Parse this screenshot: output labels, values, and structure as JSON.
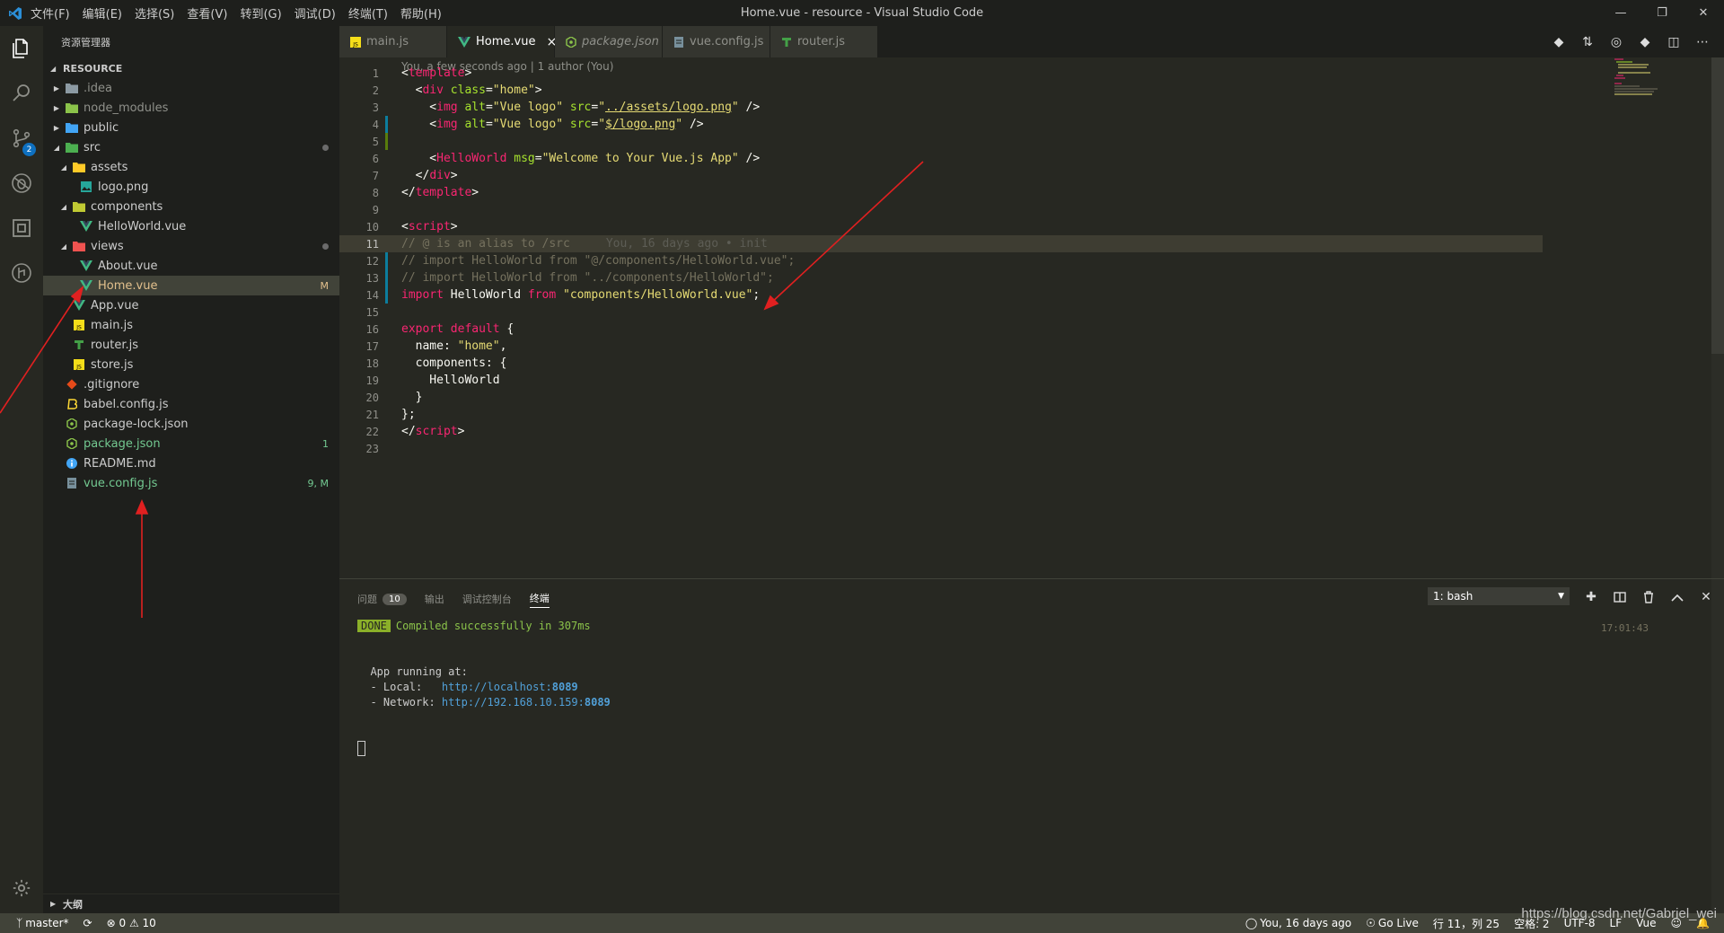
{
  "titlebar": {
    "menus": [
      "文件(F)",
      "编辑(E)",
      "选择(S)",
      "查看(V)",
      "转到(G)",
      "调试(D)",
      "终端(T)",
      "帮助(H)"
    ],
    "title": "Home.vue - resource - Visual Studio Code"
  },
  "activity": {
    "scm_badge": "2"
  },
  "sidebar": {
    "header": "资源管理器",
    "section": "RESOURCE",
    "items": [
      {
        "label": ".idea",
        "depth": 0,
        "twisty": "▶",
        "icon": "folder-icon",
        "color": "#8f908a",
        "status": ""
      },
      {
        "label": "node_modules",
        "depth": 0,
        "twisty": "▶",
        "icon": "folder-node-icon",
        "color": "#8f908a",
        "status": ""
      },
      {
        "label": "public",
        "depth": 0,
        "twisty": "▶",
        "icon": "folder-public-icon",
        "color": "#cccccc",
        "status": ""
      },
      {
        "label": "src",
        "depth": 0,
        "twisty": "◢",
        "icon": "folder-src-icon",
        "color": "#cccccc",
        "status": "dot"
      },
      {
        "label": "assets",
        "depth": 1,
        "twisty": "◢",
        "icon": "folder-assets-icon",
        "color": "#cccccc",
        "status": ""
      },
      {
        "label": "logo.png",
        "depth": 2,
        "twisty": "",
        "icon": "image-icon",
        "color": "#cccccc",
        "status": ""
      },
      {
        "label": "components",
        "depth": 1,
        "twisty": "◢",
        "icon": "folder-components-icon",
        "color": "#cccccc",
        "status": ""
      },
      {
        "label": "HelloWorld.vue",
        "depth": 2,
        "twisty": "",
        "icon": "vue-icon",
        "color": "#cccccc",
        "status": ""
      },
      {
        "label": "views",
        "depth": 1,
        "twisty": "◢",
        "icon": "folder-views-icon",
        "color": "#cccccc",
        "status": "dot"
      },
      {
        "label": "About.vue",
        "depth": 2,
        "twisty": "",
        "icon": "vue-icon",
        "color": "#cccccc",
        "status": ""
      },
      {
        "label": "Home.vue",
        "depth": 2,
        "twisty": "",
        "icon": "vue-icon",
        "color": "#e2c08d",
        "status": "M",
        "selected": true
      },
      {
        "label": "App.vue",
        "depth": 1,
        "twisty": "",
        "icon": "vue-icon",
        "color": "#cccccc",
        "status": ""
      },
      {
        "label": "main.js",
        "depth": 1,
        "twisty": "",
        "icon": "js-icon",
        "color": "#cccccc",
        "status": ""
      },
      {
        "label": "router.js",
        "depth": 1,
        "twisty": "",
        "icon": "router-icon",
        "color": "#cccccc",
        "status": ""
      },
      {
        "label": "store.js",
        "depth": 1,
        "twisty": "",
        "icon": "js-icon",
        "color": "#cccccc",
        "status": ""
      },
      {
        "label": ".gitignore",
        "depth": 0,
        "twisty": "",
        "icon": "git-icon",
        "color": "#cccccc",
        "status": ""
      },
      {
        "label": "babel.config.js",
        "depth": 0,
        "twisty": "",
        "icon": "babel-icon",
        "color": "#cccccc",
        "status": ""
      },
      {
        "label": "package-lock.json",
        "depth": 0,
        "twisty": "",
        "icon": "npm-icon",
        "color": "#cccccc",
        "status": ""
      },
      {
        "label": "package.json",
        "depth": 0,
        "twisty": "",
        "icon": "npm-icon",
        "color": "#73c991",
        "status": "1"
      },
      {
        "label": "README.md",
        "depth": 0,
        "twisty": "",
        "icon": "info-icon",
        "color": "#cccccc",
        "status": ""
      },
      {
        "label": "vue.config.js",
        "depth": 0,
        "twisty": "",
        "icon": "config-icon",
        "color": "#73c991",
        "status": "9, M"
      }
    ],
    "outline": "大纲"
  },
  "tabs": [
    {
      "label": "main.js",
      "icon": "js-icon",
      "active": false,
      "italic": false
    },
    {
      "label": "Home.vue",
      "icon": "vue-icon",
      "active": true,
      "italic": false
    },
    {
      "label": "package.json",
      "icon": "npm-icon",
      "active": false,
      "italic": true
    },
    {
      "label": "vue.config.js",
      "icon": "config-icon",
      "active": false,
      "italic": false
    },
    {
      "label": "router.js",
      "icon": "router-icon",
      "active": false,
      "italic": false
    }
  ],
  "editor": {
    "codelens": "You, a few seconds ago | 1 author (You)",
    "current_line": 11,
    "lines": [
      [
        [
          "t-pun",
          "<"
        ],
        [
          "t-tag",
          "template"
        ],
        [
          "t-pun",
          ">"
        ]
      ],
      [
        [
          "t-pun",
          "  <"
        ],
        [
          "t-tag",
          "div"
        ],
        [
          "t-attr",
          " class"
        ],
        [
          "t-pun",
          "="
        ],
        [
          "t-str",
          "\"home\""
        ],
        [
          "t-pun",
          ">"
        ]
      ],
      [
        [
          "t-pun",
          "    <"
        ],
        [
          "t-tag",
          "img"
        ],
        [
          "t-attr",
          " alt"
        ],
        [
          "t-pun",
          "="
        ],
        [
          "t-str",
          "\"Vue logo\""
        ],
        [
          "t-attr",
          " src"
        ],
        [
          "t-pun",
          "="
        ],
        [
          "t-str",
          "\""
        ],
        [
          "t-str t-ul",
          "../assets/logo.png"
        ],
        [
          "t-str",
          "\""
        ],
        [
          "t-pun",
          " />"
        ]
      ],
      [
        [
          "t-pun",
          "    <"
        ],
        [
          "t-tag",
          "img"
        ],
        [
          "t-attr",
          " alt"
        ],
        [
          "t-pun",
          "="
        ],
        [
          "t-str",
          "\"Vue logo\""
        ],
        [
          "t-attr",
          " src"
        ],
        [
          "t-pun",
          "="
        ],
        [
          "t-str",
          "\""
        ],
        [
          "t-str t-ul",
          "$/logo.png"
        ],
        [
          "t-str",
          "\""
        ],
        [
          "t-pun",
          " />"
        ]
      ],
      [],
      [
        [
          "t-pun",
          "    <"
        ],
        [
          "t-tag",
          "HelloWorld"
        ],
        [
          "t-attr",
          " msg"
        ],
        [
          "t-pun",
          "="
        ],
        [
          "t-str",
          "\"Welcome to Your Vue.js App\""
        ],
        [
          "t-pun",
          " />"
        ]
      ],
      [
        [
          "t-pun",
          "  </"
        ],
        [
          "t-tag",
          "div"
        ],
        [
          "t-pun",
          ">"
        ]
      ],
      [
        [
          "t-pun",
          "</"
        ],
        [
          "t-tag",
          "template"
        ],
        [
          "t-pun",
          ">"
        ]
      ],
      [],
      [
        [
          "t-pun",
          "<"
        ],
        [
          "t-tag",
          "script"
        ],
        [
          "t-pun",
          ">"
        ]
      ],
      [
        [
          "t-com",
          "// @ is an alias to /src"
        ],
        [
          "blame",
          "You, 16 days ago • init"
        ]
      ],
      [
        [
          "t-com",
          "// import HelloWorld from \"@/components/HelloWorld.vue\";"
        ]
      ],
      [
        [
          "t-com",
          "// import HelloWorld from \"../components/HelloWorld\";"
        ]
      ],
      [
        [
          "t-kw",
          "import"
        ],
        [
          "t-pun",
          " HelloWorld "
        ],
        [
          "t-kw",
          "from"
        ],
        [
          "t-str",
          " \"components/HelloWorld.vue\""
        ],
        [
          "t-pun",
          ";"
        ]
      ],
      [],
      [
        [
          "t-kw",
          "export default"
        ],
        [
          "t-pun",
          " {"
        ]
      ],
      [
        [
          "t-pun",
          "  name: "
        ],
        [
          "t-str",
          "\"home\""
        ],
        [
          "t-pun",
          ","
        ]
      ],
      [
        [
          "t-pun",
          "  components: {"
        ]
      ],
      [
        [
          "t-pun",
          "    HelloWorld"
        ]
      ],
      [
        [
          "t-pun",
          "  }"
        ]
      ],
      [
        [
          "t-pun",
          "};"
        ]
      ],
      [
        [
          "t-pun",
          "</"
        ],
        [
          "t-tag",
          "script"
        ],
        [
          "t-pun",
          ">"
        ]
      ],
      []
    ],
    "modified_lines": [
      4,
      5,
      12,
      13,
      14
    ]
  },
  "panel": {
    "tabs": [
      {
        "label": "问题",
        "count": "10",
        "active": false
      },
      {
        "label": "输出",
        "count": "",
        "active": false
      },
      {
        "label": "调试控制台",
        "count": "",
        "active": false
      },
      {
        "label": "终端",
        "count": "",
        "active": true
      }
    ],
    "terminal_select": "1: bash",
    "time": "17:01:43",
    "done_badge": "DONE",
    "compiled": "Compiled successfully in 307ms",
    "app_running": "App running at:",
    "local_label": "  - Local:   ",
    "local_url": "http://localhost:",
    "local_port": "8089",
    "network_label": "  - Network: ",
    "network_url": "http://192.168.10.159:",
    "network_port": "8089"
  },
  "statusbar": {
    "branch": "master*",
    "errors": "0",
    "warnings": "10",
    "blame": "You, 16 days ago",
    "golive": "Go Live",
    "position": "行 11，列 25",
    "spaces": "空格: 2",
    "encoding": "UTF-8",
    "eol": "LF",
    "language": "Vue"
  },
  "watermark": "https://blog.csdn.net/Gabriel_wei",
  "colors": {
    "accent": "#0e70c0",
    "annotation_arrow": "#e02020"
  }
}
